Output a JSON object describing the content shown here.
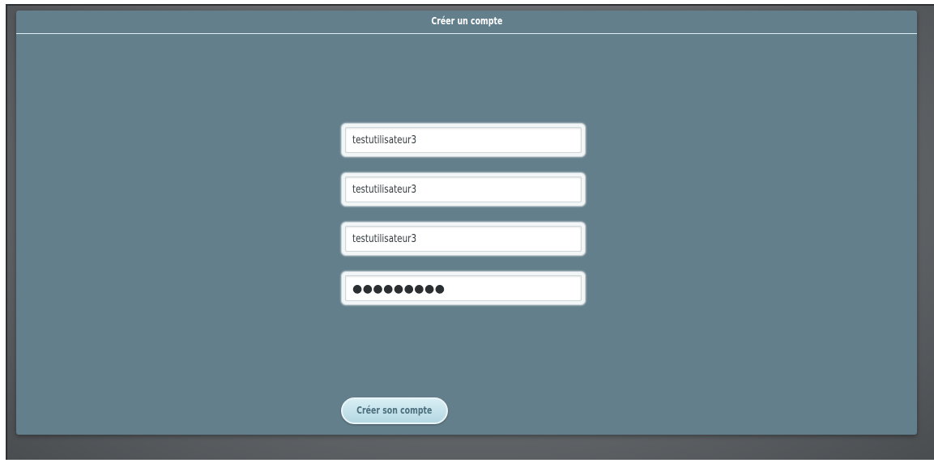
{
  "panel": {
    "title": "Créer un compte"
  },
  "form": {
    "fields": [
      {
        "value": "testutilisateur3"
      },
      {
        "value": "testutilisateur3"
      },
      {
        "value": "testutilisateur3"
      },
      {
        "value": "●●●●●●●●●"
      }
    ],
    "submit_label": "Créer son compte"
  },
  "colors": {
    "panel_background": "#647f8c",
    "button_background": "#c6e4ec",
    "button_text": "#4b6f7d"
  }
}
